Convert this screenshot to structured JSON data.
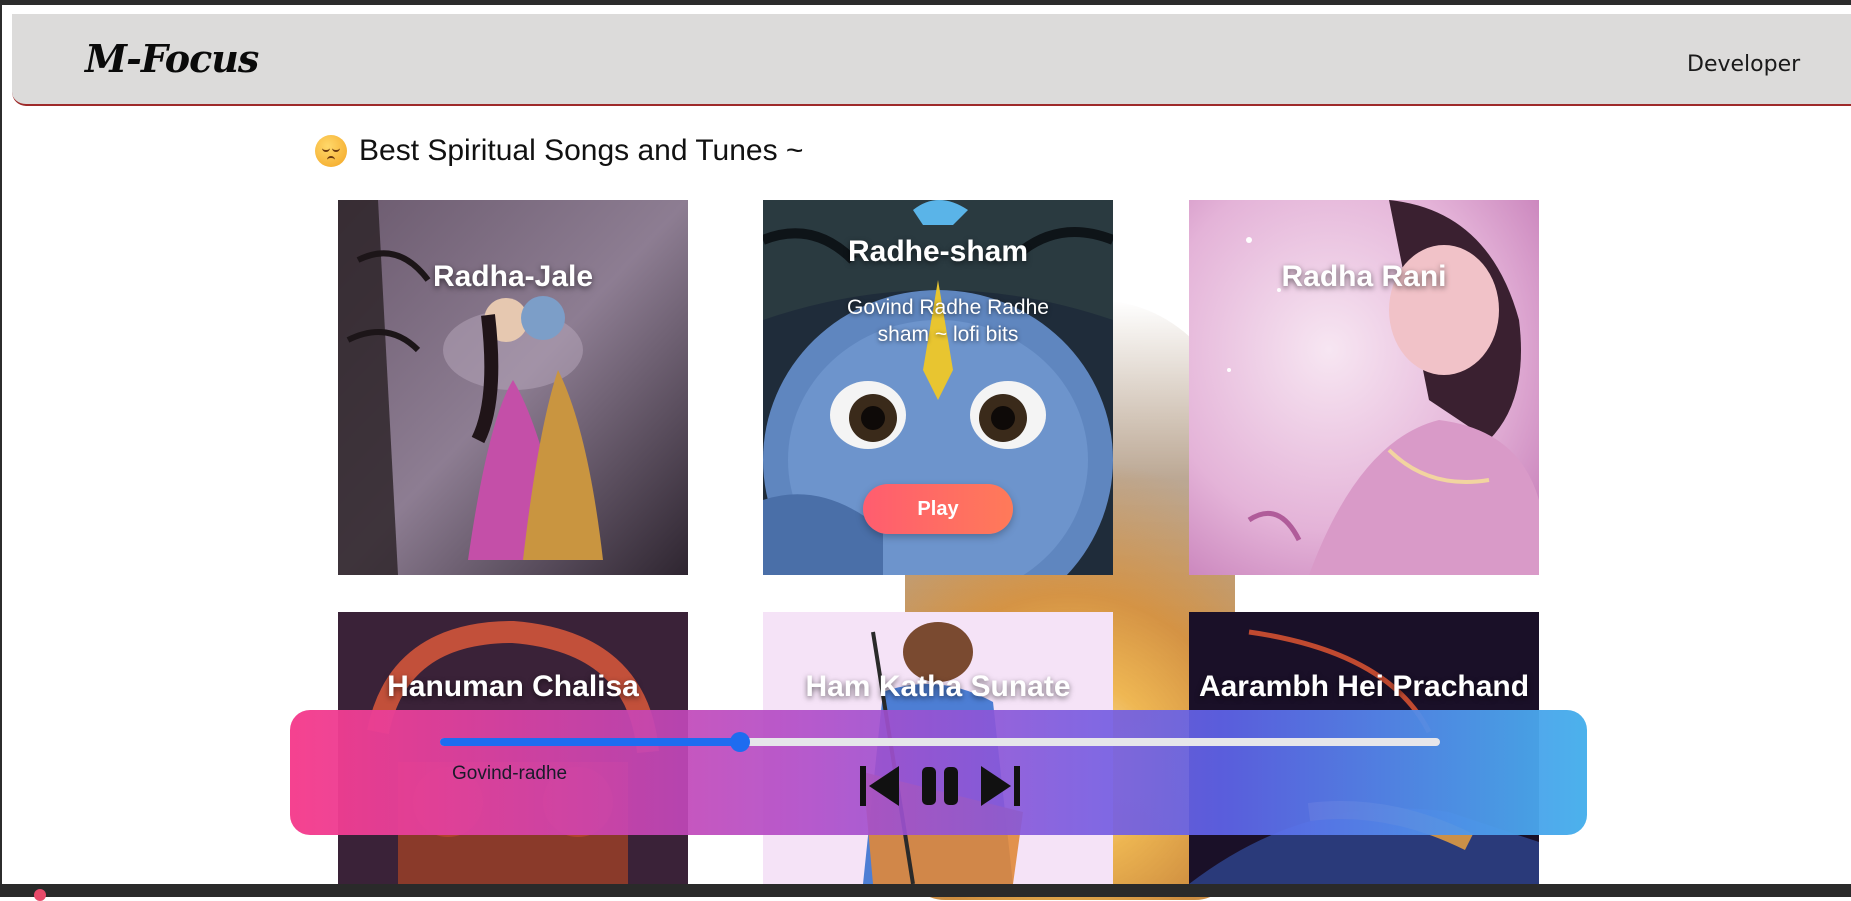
{
  "app": {
    "brand": "M-Focus",
    "nav_link": "Developer"
  },
  "section": {
    "title": "Best Spiritual Songs and Tunes ~",
    "emoji": "relieved-face-icon"
  },
  "cards": [
    {
      "title": "Radha-Jale",
      "subtitle": "",
      "palette": [
        "#5a4a5e",
        "#8a6a92",
        "#c44fa8",
        "#2e2530"
      ]
    },
    {
      "title": "Radhe-sham",
      "subtitle": "Govind Radhe Radhe sham ~ lofi bits",
      "play_label": "Play",
      "palette": [
        "#1a2a3a",
        "#6a8fc4",
        "#3b5f9a",
        "#d4c040"
      ]
    },
    {
      "title": "Radha Rani",
      "subtitle": "",
      "palette": [
        "#efd3ea",
        "#e7a9d8",
        "#c67bb8",
        "#f6e4f0"
      ]
    },
    {
      "title": "Hanuman Chalisa",
      "subtitle": "",
      "palette": [
        "#3a2238",
        "#7a3040",
        "#c25030",
        "#2a1a2a"
      ]
    },
    {
      "title": "Ham Katha Sunate",
      "subtitle": "",
      "palette": [
        "#f4e2f6",
        "#8b5a3a",
        "#4a7ad0",
        "#e08a40"
      ]
    },
    {
      "title": "Aarambh Hei Prachand",
      "subtitle": "",
      "palette": [
        "#1a1028",
        "#c04a30",
        "#e8a040",
        "#2a3a7a"
      ]
    }
  ],
  "player": {
    "track_name": "Govind-radhe",
    "progress": 0.3,
    "controls": {
      "prev": "skip-previous-icon",
      "pause": "pause-icon",
      "next": "skip-next-icon"
    },
    "colors": {
      "accent": "#1e6cf0",
      "gradient_start": "#f53c8c",
      "gradient_end": "#46afeb"
    }
  }
}
